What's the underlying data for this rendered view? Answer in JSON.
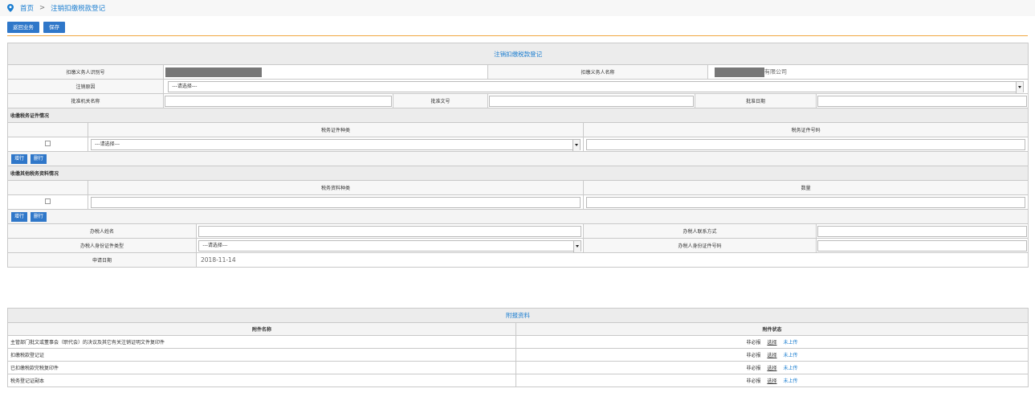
{
  "breadcrumb": {
    "home": "首页",
    "separator": ">",
    "current": "注销扣缴税款登记"
  },
  "toolbar": {
    "back_label": "返回业务",
    "save_label": "保存"
  },
  "form": {
    "title": "注销扣缴税款登记",
    "withholder_id_label": "扣缴义务人识别号",
    "withholder_name_label": "扣缴义务人名称",
    "withholder_name_suffix": "有限公司",
    "cancel_reason_label": "注销原因",
    "cancel_reason_value": "---请选择---",
    "approval_authority_label": "批准机关名称",
    "approval_doc_label": "批准文号",
    "approval_date_label": "批准日期",
    "tax_cert_section": "收缴税务证件情况",
    "tax_cert_type_header": "税务证件种类",
    "tax_cert_no_header": "税务证件号码",
    "tax_cert_type_value": "---请选择---",
    "add_row_label": "增行",
    "del_row_label": "删行",
    "other_docs_section": "收缴其他税务资料情况",
    "doc_name_header": "税务资料种类",
    "quantity_header": "数量",
    "handler_name_label": "办税人姓名",
    "handler_contact_label": "办税人联系方式",
    "handler_id_type_label": "办税人身份证件类型",
    "handler_id_type_value": "---请选择---",
    "handler_id_no_label": "办税人身份证件号码",
    "apply_date_label": "申请日期",
    "apply_date_value": "2018-11-14"
  },
  "attachments": {
    "title": "附报资料",
    "name_header": "附件名称",
    "status_header": "附件状态",
    "required_label": "非必报",
    "choose_label": "选择",
    "upload_status": "未上传",
    "items": [
      "主管部门批文或董事会（职代会）的决议及其它有关注销证明文件复印件",
      "扣缴税款登记证",
      "已扣缴税款完税复印件",
      "税务登记证副本"
    ]
  }
}
